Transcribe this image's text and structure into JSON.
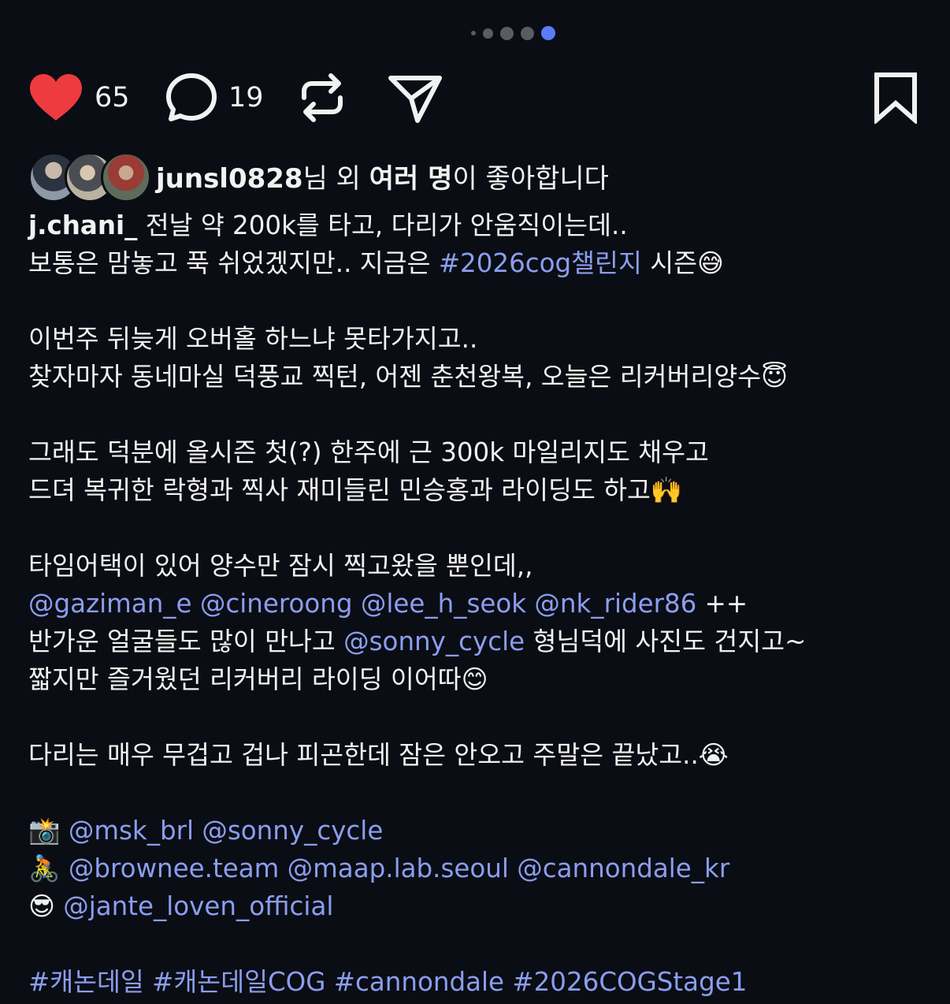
{
  "carousel": {
    "dot_count": 5,
    "active_index": 4
  },
  "actions": {
    "like_count": "65",
    "comment_count": "19",
    "like_color": "#ee3b3f",
    "icons": [
      "heart-icon",
      "comment-icon",
      "repost-icon",
      "share-icon",
      "bookmark-icon"
    ]
  },
  "likes": {
    "user": "junsl0828",
    "text_mid": "님 외 ",
    "others": "여러 명",
    "text_end": "이 좋아합니다"
  },
  "caption": {
    "author": "j.chani_",
    "l1": " 전날 약 200k를 타고, 다리가 안움직이는데..",
    "l2a": "보통은 맘놓고 푹 쉬었겠지만.. 지금은 ",
    "l2_tag": "#2026cog챌린지",
    "l2b": " 시즌😅",
    "l3": "이번주 뒤늦게 오버홀 하느냐 못타가지고..",
    "l4": "찾자마자 동네마실 덕풍교 찍턴, 어젠 춘천왕복, 오늘은 리커버리양수😇",
    "l5": "그래도 덕분에 올시즌 첫(?) 한주에 근 300k 마일리지도 채우고",
    "l6": "드뎌 복귀한 락형과 찍사 재미들린 민승홍과 라이딩도 하고🙌",
    "l7": "타임어택이 있어 양수만 잠시 찍고왔을 뿐인데,,",
    "l8_mentions": "@gaziman_e @cineroong @lee_h_seok @nk_rider86",
    "l8_end": " ++",
    "l9a": "반가운 얼굴들도 많이 만나고 ",
    "l9_mention": "@sonny_cycle",
    "l9b": " 형님덕에 사진도 건지고~",
    "l10": "짧지만 즐거웠던 리커버리 라이딩 이어따😊",
    "l11": "다리는 매우 무겁고 겁나 피곤한데 잠은 안오고 주말은 끝났고..😭",
    "credit1_emoji": "📸",
    "credit1": "@msk_brl @sonny_cycle",
    "credit2_emoji": "🚴",
    "credit2": "@brownee.team @maap.lab.seoul @cannondale_kr",
    "credit3_emoji": "😎",
    "credit3": "@jante_loven_official",
    "hashtags": "#캐논데일 #캐논데일COG #cannondale #2026COGStage1"
  }
}
